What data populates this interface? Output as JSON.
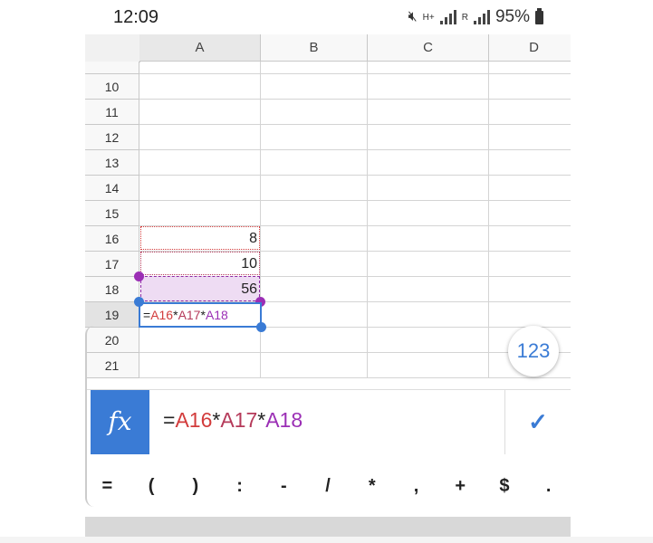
{
  "status": {
    "time": "12:09",
    "network_label": "H+",
    "sim_label": "R",
    "battery": "95%"
  },
  "columns": [
    "A",
    "B",
    "C",
    "D"
  ],
  "rows": [
    "10",
    "11",
    "12",
    "13",
    "14",
    "15",
    "16",
    "17",
    "18",
    "19",
    "20",
    "21"
  ],
  "cells": {
    "A16": "8",
    "A17": "10",
    "A18": "56"
  },
  "editing": {
    "cell": "A19",
    "formula_parts": [
      "=",
      "A16",
      "*",
      "A17",
      "*",
      "A18"
    ]
  },
  "fab_label": "123",
  "formula_bar": {
    "fx_label": "fx",
    "confirm_icon": "checkmark-icon"
  },
  "symbols": [
    "=",
    "(",
    ")",
    ":",
    "-",
    "/",
    "*",
    ",",
    "+",
    "$",
    "."
  ],
  "colors": {
    "accent": "#3a7bd5",
    "ref1": "#d23c3c",
    "ref2": "#b53a5a",
    "ref3": "#9b2fb5"
  }
}
